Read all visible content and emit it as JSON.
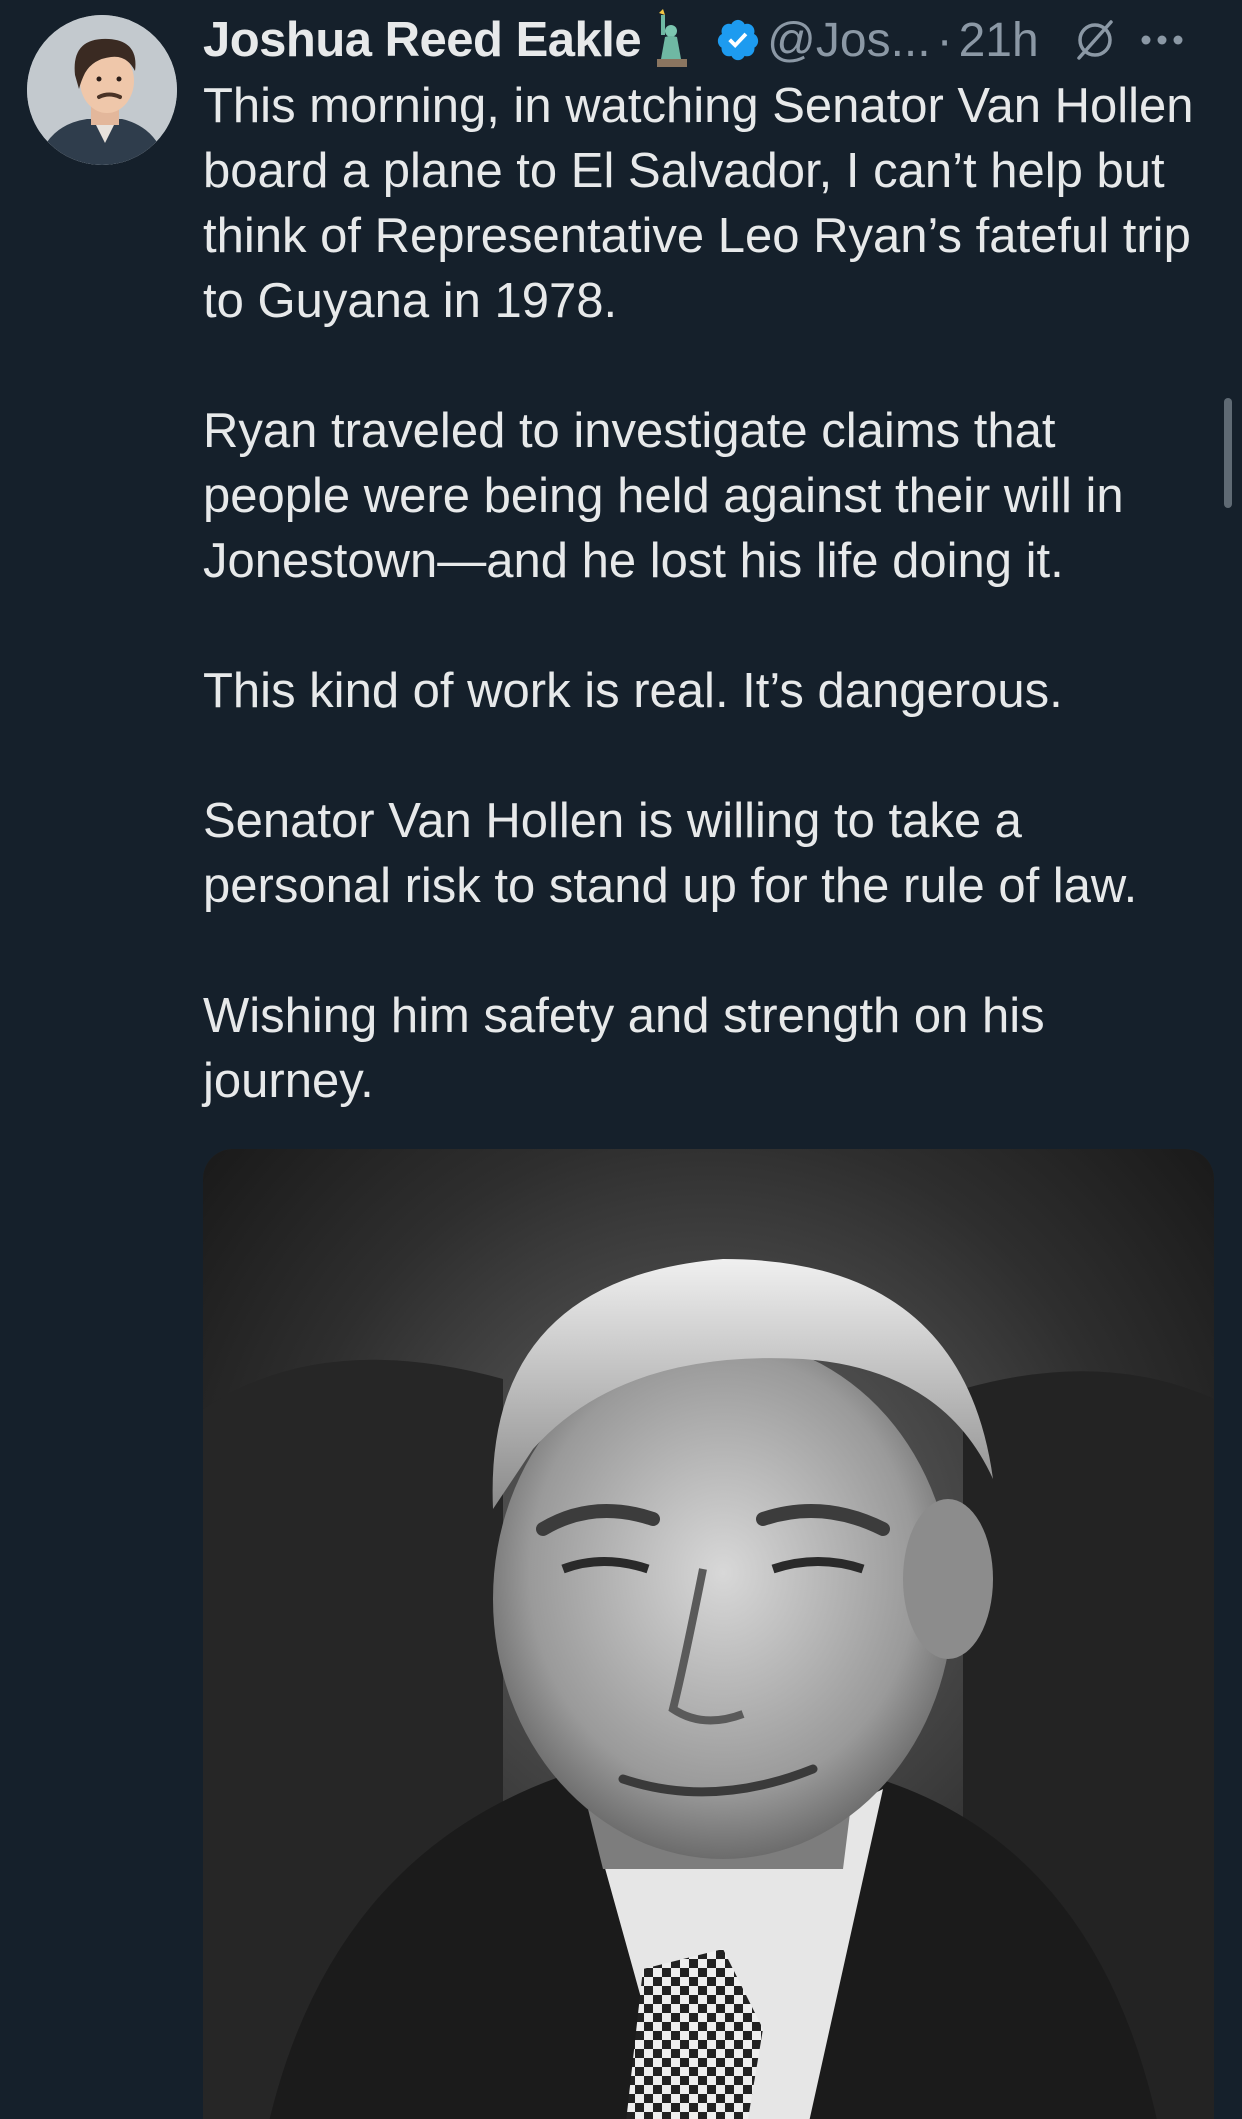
{
  "author": {
    "display_name": "Joshua Reed Eakle",
    "handle": "@Jos...",
    "separator": "·",
    "timestamp": "21h",
    "badge_icon": "statue-of-liberty-icon",
    "verified_icon": "verified-badge-icon",
    "verified_color": "#1d9bf0"
  },
  "tweet": {
    "paragraphs": [
      "This morning, in watching Senator Van Hollen board a plane to El Salvador, I can’t help but think of Representative Leo Ryan’s fateful trip to Guyana in 1978.",
      "Ryan traveled to investigate claims that people were being held against their will in Jonestown—and he lost his life doing it.",
      "This kind of work is real. It’s dangerous.",
      "Senator Van Hollen is willing to take a personal risk to stand up for the rule of law.",
      "Wishing him safety and strength on his journey."
    ]
  },
  "media": {
    "kind": "black-and-white portrait photo"
  },
  "icons": {
    "grok": "grok-icon",
    "more": "more-options-icon"
  },
  "colors": {
    "background": "#15202b",
    "text": "#e7e9ea",
    "secondary_text": "#8b98a5"
  }
}
